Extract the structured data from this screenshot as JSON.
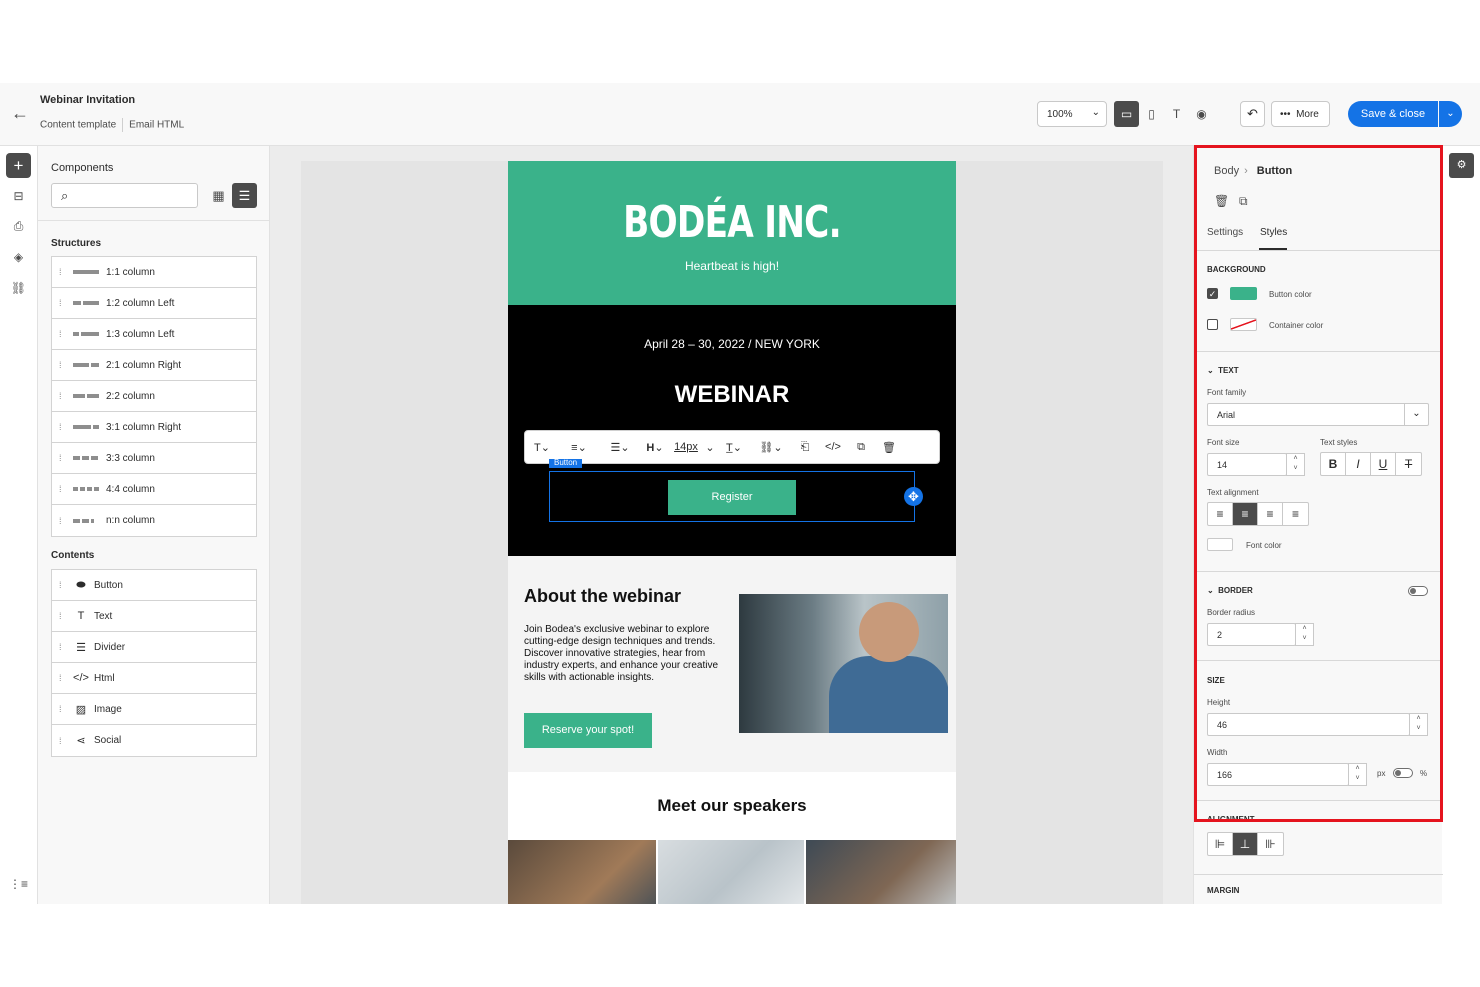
{
  "header": {
    "title": "Webinar Invitation",
    "subtitle_left": "Content template",
    "subtitle_right": "Email HTML",
    "zoom": "100%",
    "more_label": "More",
    "save_label": "Save & close"
  },
  "components": {
    "title": "Components",
    "search_placeholder": "",
    "structures_title": "Structures",
    "structures": [
      {
        "label": "1:1 column"
      },
      {
        "label": "1:2 column Left"
      },
      {
        "label": "1:3 column Left"
      },
      {
        "label": "2:1 column Right"
      },
      {
        "label": "2:2 column"
      },
      {
        "label": "3:1 column Right"
      },
      {
        "label": "3:3 column"
      },
      {
        "label": "4:4 column"
      },
      {
        "label": "n:n column"
      }
    ],
    "contents_title": "Contents",
    "contents": [
      {
        "label": "Button",
        "icon": "button-icon"
      },
      {
        "label": "Text",
        "icon": "text-icon"
      },
      {
        "label": "Divider",
        "icon": "divider-icon"
      },
      {
        "label": "Html",
        "icon": "code-icon"
      },
      {
        "label": "Image",
        "icon": "image-icon"
      },
      {
        "label": "Social",
        "icon": "share-icon"
      }
    ]
  },
  "email": {
    "logo": "BODÉA INC.",
    "tagline": "Heartbeat is high!",
    "date": "April 28 – 30, 2022 / NEW YORK",
    "headline": "WEBINAR",
    "toolbar_fontsize": "14px",
    "toolbar_heading": "H",
    "selected_label": "Button",
    "register_label": "Register",
    "about_title": "About the webinar",
    "about_text": "Join Bodea's exclusive webinar to explore cutting-edge design techniques and trends. Discover innovative strategies, hear from industry experts, and enhance your creative skills with actionable insights.",
    "reserve_label": "Reserve your spot!",
    "speakers_title": "Meet our speakers"
  },
  "panel": {
    "crumb_parent": "Body",
    "crumb_current": "Button",
    "tab_settings": "Settings",
    "tab_styles": "Styles",
    "background_title": "BACKGROUND",
    "button_color_label": "Button color",
    "container_color_label": "Container color",
    "button_color": "#3ab28a",
    "text_title": "TEXT",
    "font_family_label": "Font family",
    "font_family_value": "Arial",
    "font_size_label": "Font size",
    "font_size_value": "14",
    "text_styles_label": "Text styles",
    "text_alignment_label": "Text alignment",
    "font_color_label": "Font color",
    "border_title": "BORDER",
    "border_radius_label": "Border radius",
    "border_radius_value": "2",
    "size_title": "SIZE",
    "height_label": "Height",
    "height_value": "46",
    "width_label": "Width",
    "width_value": "166",
    "unit_px": "px",
    "unit_pct": "%",
    "alignment_title": "ALIGNMENT",
    "margin_title": "MARGIN"
  }
}
